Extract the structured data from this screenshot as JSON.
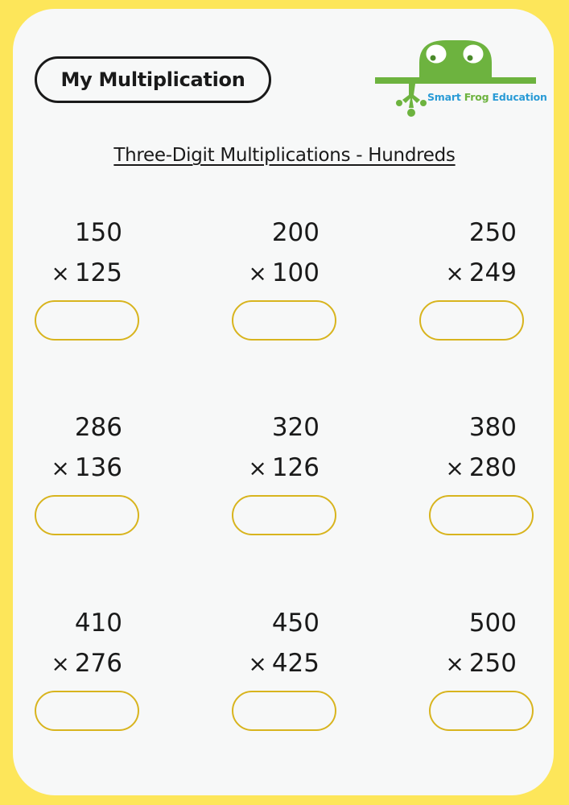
{
  "worksheet": {
    "title": "My Multiplication",
    "subtitle": "Three-Digit Multiplications - Hundreds",
    "brand": {
      "name_part1": "Smart ",
      "name_part2": "Frog",
      "name_part3": " Education",
      "colors": {
        "green": "#6db33f",
        "blue": "#2a9bd6"
      }
    },
    "operator_symbol": "×",
    "colors": {
      "border": "#fde65a",
      "answer_outline": "#d8b41e",
      "text": "#1a1a1a"
    },
    "problems": [
      {
        "top": "150",
        "bottom": "125",
        "answer": ""
      },
      {
        "top": "200",
        "bottom": "100",
        "answer": ""
      },
      {
        "top": "250",
        "bottom": "249",
        "answer": ""
      },
      {
        "top": "286",
        "bottom": "136",
        "answer": ""
      },
      {
        "top": "320",
        "bottom": "126",
        "answer": ""
      },
      {
        "top": "380",
        "bottom": "280",
        "answer": ""
      },
      {
        "top": "410",
        "bottom": "276",
        "answer": ""
      },
      {
        "top": "450",
        "bottom": "425",
        "answer": ""
      },
      {
        "top": "500",
        "bottom": "250",
        "answer": ""
      }
    ]
  }
}
